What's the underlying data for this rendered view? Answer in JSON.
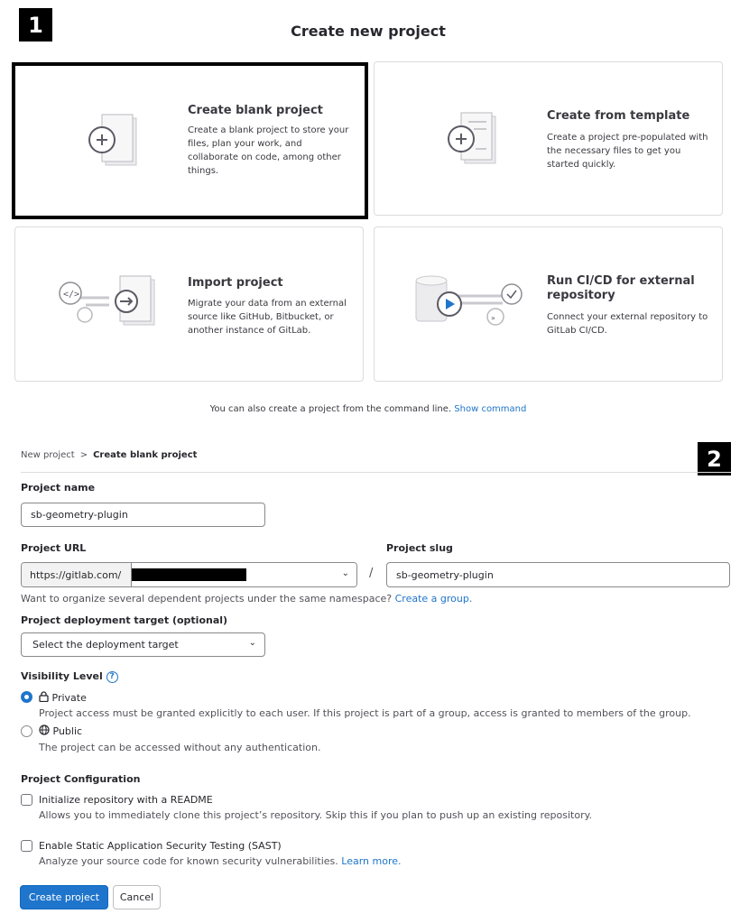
{
  "badges": {
    "step1": "1",
    "step2": "2"
  },
  "page_title": "Create new project",
  "cards": [
    {
      "title": "Create blank project",
      "description": "Create a blank project to store your files, plan your work, and collaborate on code, among other things.",
      "icon": "blank-project-illustration"
    },
    {
      "title": "Create from template",
      "description": "Create a project pre-populated with the necessary files to get you started quickly.",
      "icon": "template-project-illustration"
    },
    {
      "title": "Import project",
      "description": "Migrate your data from an external source like GitHub, Bitbucket, or another instance of GitLab.",
      "icon": "import-project-illustration"
    },
    {
      "title": "Run CI/CD for external repository",
      "description": "Connect your external repository to GitLab CI/CD.",
      "icon": "cicd-illustration"
    }
  ],
  "command_line": {
    "text": "You can also create a project from the command line.",
    "link": "Show command"
  },
  "breadcrumb": {
    "parent": "New project",
    "separator": ">",
    "current": "Create blank project"
  },
  "form": {
    "project_name_label": "Project name",
    "project_name_value": "sb-geometry-plugin",
    "project_url_label": "Project URL",
    "url_prefix": "https://gitlab.com/",
    "slug_separator": "/",
    "project_slug_label": "Project slug",
    "project_slug_value": "sb-geometry-plugin",
    "group_help_text": "Want to organize several dependent projects under the same namespace?",
    "group_help_link": "Create a group.",
    "deployment_label": "Project deployment target (optional)",
    "deployment_select": "Select the deployment target",
    "visibility_label": "Visibility Level",
    "visibility_help_icon": "?",
    "visibility_options": [
      {
        "label": "Private",
        "help": "Project access must be granted explicitly to each user. If this project is part of a group, access is granted to members of the group.",
        "checked": true,
        "icon": "lock-icon"
      },
      {
        "label": "Public",
        "help": "The project can be accessed without any authentication.",
        "checked": false,
        "icon": "globe-icon"
      }
    ],
    "config_label": "Project Configuration",
    "config_options": [
      {
        "label": "Initialize repository with a README",
        "help": "Allows you to immediately clone this project’s repository. Skip this if you plan to push up an existing repository.",
        "checked": false
      },
      {
        "label": "Enable Static Application Security Testing (SAST)",
        "help": "Analyze your source code for known security vulnerabilities.",
        "link": "Learn more.",
        "checked": false
      }
    ],
    "create_button": "Create project",
    "cancel_button": "Cancel"
  },
  "colors": {
    "primary": "#1f75cb",
    "border": "#dcdcde",
    "text": "#28272d"
  }
}
